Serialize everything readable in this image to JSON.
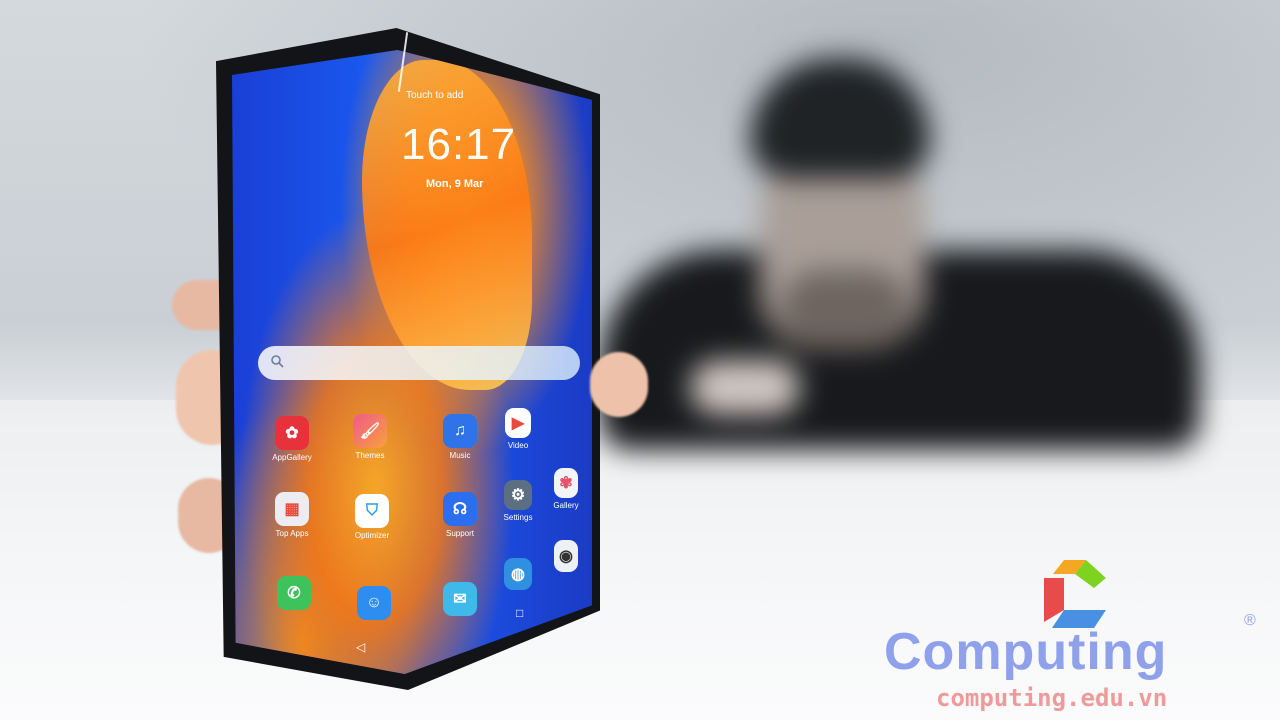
{
  "phone": {
    "status_text": "Touch to add",
    "clock": "16:17",
    "date": "Mon, 9 Mar"
  },
  "apps": [
    {
      "label": "AppGallery",
      "icon": "huawei-appgallery-icon",
      "color": "#e7323c"
    },
    {
      "label": "Themes",
      "icon": "themes-brush-icon",
      "color": "#e8506c"
    },
    {
      "label": "Music",
      "icon": "music-note-icon",
      "color": "#2f73e8"
    },
    {
      "label": "Video",
      "icon": "video-play-icon",
      "color": "#e94a3b"
    },
    {
      "label": "Top Apps",
      "icon": "top-apps-folder-icon",
      "color": "#e9e9ee"
    },
    {
      "label": "Optimizer",
      "icon": "shield-check-icon",
      "color": "#2aa0e6"
    },
    {
      "label": "Support",
      "icon": "support-headset-icon",
      "color": "#2b6ef0"
    },
    {
      "label": "Settings",
      "icon": "gear-icon",
      "color": "#5c6f82"
    },
    {
      "label": "Gallery",
      "icon": "gallery-flower-icon",
      "color": "#f2f4f6"
    },
    {
      "label": "",
      "icon": "phone-call-icon",
      "color": "#3ec25c"
    },
    {
      "label": "",
      "icon": "contacts-icon",
      "color": "#2d8df0"
    },
    {
      "label": "",
      "icon": "messages-icon",
      "color": "#3fb9e9"
    },
    {
      "label": "",
      "icon": "browser-globe-icon",
      "color": "#2f8fe0"
    },
    {
      "label": "",
      "icon": "camera-icon",
      "color": "#eef1f4"
    }
  ],
  "watermark": {
    "title": "Computing",
    "url": "computing.edu.vn",
    "registered": "®",
    "logo_colors": [
      "#f5a623",
      "#e94b4b",
      "#4a90e2",
      "#7ed321"
    ]
  }
}
